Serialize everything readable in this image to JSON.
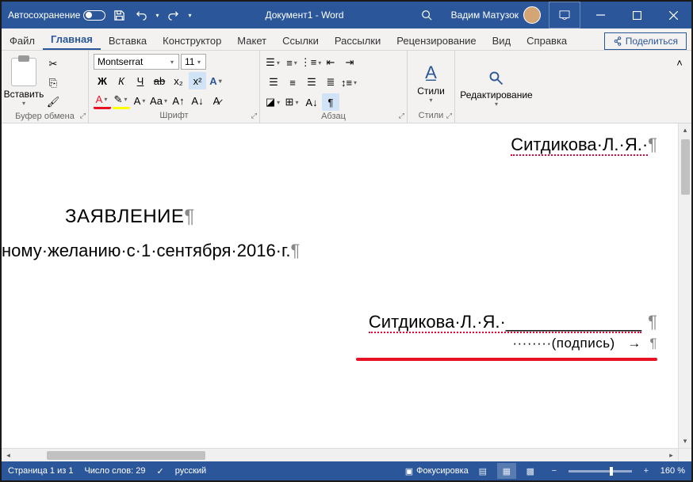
{
  "titlebar": {
    "autosave": "Автосохранение",
    "docTitle": "Документ1 - Word",
    "user": "Вадим Матузок"
  },
  "tabs": {
    "file": "Файл",
    "home": "Главная",
    "insert": "Вставка",
    "design": "Конструктор",
    "layout": "Макет",
    "references": "Ссылки",
    "mailings": "Рассылки",
    "review": "Рецензирование",
    "view": "Вид",
    "help": "Справка",
    "share": "Поделиться"
  },
  "ribbon": {
    "paste": "Вставить",
    "clipboard": "Буфер обмена",
    "fontName": "Montserrat",
    "fontSize": "11",
    "fontGroup": "Шрифт",
    "paraGroup": "Абзац",
    "styles": "Стили",
    "editing": "Редактирование"
  },
  "doc": {
    "name1": "Ситдикова·Л.·Я.·",
    "title": "ЗАЯВЛЕНИЕ",
    "body": "ному·желанию·с·1·сентября·2016·г.",
    "name2": "Ситдикова·Л.·Я.·______________",
    "signature": "········(подпись)",
    "pil": "¶"
  },
  "status": {
    "page": "Страница 1 из 1",
    "words": "Число слов: 29",
    "lang": "русский",
    "focus": "Фокусировка",
    "zoom": "160 %"
  }
}
